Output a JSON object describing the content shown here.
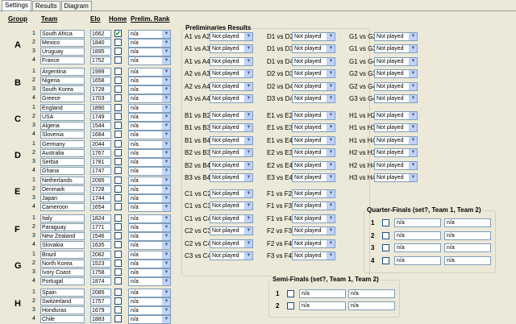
{
  "tabs": [
    "Settings",
    "Results",
    "Diagram"
  ],
  "headers": {
    "group": "Group",
    "team": "Team",
    "elo": "Elo",
    "home": "Home",
    "rank": "Prelim. Rank"
  },
  "groups": [
    {
      "letter": "A",
      "teams": [
        {
          "name": "South Africa",
          "elo": "1662",
          "home": true
        },
        {
          "name": "Mexico",
          "elo": "1840",
          "home": false
        },
        {
          "name": "Uruguay",
          "elo": "1895",
          "home": false
        },
        {
          "name": "France",
          "elo": "1752",
          "home": false
        }
      ]
    },
    {
      "letter": "B",
      "teams": [
        {
          "name": "Argentina",
          "elo": "1999",
          "home": false
        },
        {
          "name": "Nigeria",
          "elo": "1658",
          "home": false
        },
        {
          "name": "South Korea",
          "elo": "1728",
          "home": false
        },
        {
          "name": "Greece",
          "elo": "1703",
          "home": false
        }
      ]
    },
    {
      "letter": "C",
      "teams": [
        {
          "name": "England",
          "elo": "1890",
          "home": false
        },
        {
          "name": "USA",
          "elo": "1749",
          "home": false
        },
        {
          "name": "Algeria",
          "elo": "1544",
          "home": false
        },
        {
          "name": "Slovenia",
          "elo": "1684",
          "home": false
        }
      ]
    },
    {
      "letter": "D",
      "teams": [
        {
          "name": "Germany",
          "elo": "2044",
          "home": false
        },
        {
          "name": "Australia",
          "elo": "1767",
          "home": false
        },
        {
          "name": "Serbia",
          "elo": "1781",
          "home": false
        },
        {
          "name": "Ghana",
          "elo": "1747",
          "home": false
        }
      ]
    },
    {
      "letter": "E",
      "teams": [
        {
          "name": "Netherlands",
          "elo": "2095",
          "home": false
        },
        {
          "name": "Denmark",
          "elo": "1728",
          "home": false
        },
        {
          "name": "Japan",
          "elo": "1744",
          "home": false
        },
        {
          "name": "Cameroon",
          "elo": "1654",
          "home": false
        }
      ]
    },
    {
      "letter": "F",
      "teams": [
        {
          "name": "Italy",
          "elo": "1824",
          "home": false
        },
        {
          "name": "Paraguay",
          "elo": "1771",
          "home": false
        },
        {
          "name": "New Zealand",
          "elo": "1546",
          "home": false
        },
        {
          "name": "Slovakia",
          "elo": "1635",
          "home": false
        }
      ]
    },
    {
      "letter": "G",
      "teams": [
        {
          "name": "Brazil",
          "elo": "2082",
          "home": false
        },
        {
          "name": "North Korea",
          "elo": "1523",
          "home": false
        },
        {
          "name": "Ivory Coast",
          "elo": "1758",
          "home": false
        },
        {
          "name": "Portugal",
          "elo": "1874",
          "home": false
        }
      ]
    },
    {
      "letter": "H",
      "teams": [
        {
          "name": "Spain",
          "elo": "2085",
          "home": false
        },
        {
          "name": "Switzerland",
          "elo": "1757",
          "home": false
        },
        {
          "name": "Honduras",
          "elo": "1679",
          "home": false
        },
        {
          "name": "Chile",
          "elo": "1883",
          "home": false
        }
      ]
    }
  ],
  "rank_value": "n/a",
  "prelim": {
    "title": "Preliminaries Results",
    "default_value": "Not played",
    "columns": [
      [
        [
          "A1 vs A2",
          "A1 vs A3",
          "A1 vs A4",
          "A2 vs A3",
          "A2 vs A4",
          "A3 vs A4"
        ],
        [
          "B1 vs B2",
          "B1 vs B3",
          "B1 vs B4",
          "B2 vs B3",
          "B2 vs B4",
          "B3 vs B4"
        ],
        [
          "C1 vs C2",
          "C1 vs C3",
          "C1 vs C4",
          "C2 vs C3",
          "C2 vs C4",
          "C3 vs C4"
        ]
      ],
      [
        [
          "D1 vs D2",
          "D1 vs D3",
          "D1 vs D4",
          "D2 vs D3",
          "D2 vs D4",
          "D3 vs D4"
        ],
        [
          "E1 vs E2",
          "E1 vs E3",
          "E1 vs E4",
          "E2 vs E3",
          "E2 vs E4",
          "E3 vs E4"
        ],
        [
          "F1 vs F2",
          "F1 vs F3",
          "F1 vs F4",
          "F2 vs F3",
          "F2 vs F4",
          "F3 vs F4"
        ]
      ],
      [
        [
          "G1 vs G2",
          "G1 vs G3",
          "G1 vs G4",
          "G2 vs G3",
          "G2 vs G4",
          "G3 vs G4"
        ],
        [
          "H1 vs H2",
          "H1 vs H3",
          "H1 vs H4",
          "H2 vs H3",
          "H2 vs H4",
          "H3 vs H4"
        ]
      ]
    ]
  },
  "quarter": {
    "title": "Quarter-Finals (set?, Team 1, Team 2)",
    "rows": [
      {
        "n": "1",
        "t1": "n/a",
        "t2": "n/a"
      },
      {
        "n": "2",
        "t1": "n/a",
        "t2": "n/a"
      },
      {
        "n": "3",
        "t1": "n/a",
        "t2": "n/a"
      },
      {
        "n": "4",
        "t1": "n/a",
        "t2": "n/a"
      }
    ]
  },
  "semi": {
    "title": "Semi-Finals (set?, Team 1, Team 2)",
    "rows": [
      {
        "n": "1",
        "t1": "n/a",
        "t2": "n/a"
      },
      {
        "n": "2",
        "t1": "n/a",
        "t2": "n/a"
      }
    ]
  }
}
